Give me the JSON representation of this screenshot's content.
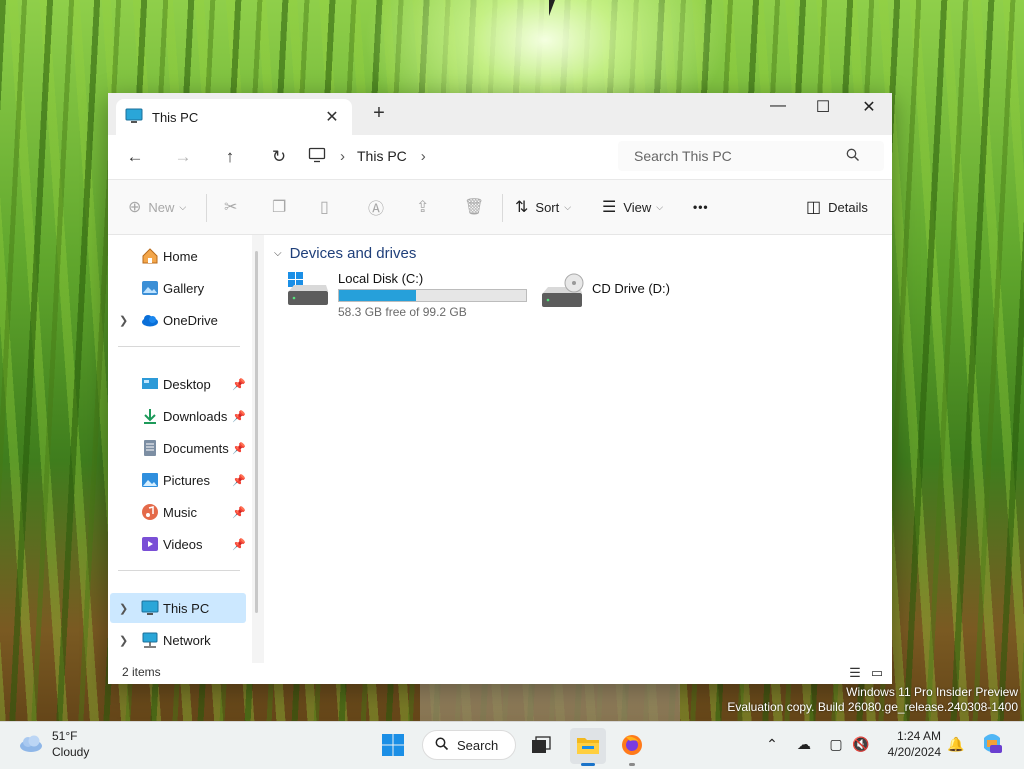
{
  "window": {
    "tab_title": "This PC",
    "tab_close": "✕",
    "new_tab": "+",
    "minimize": "—",
    "maximize": "☐",
    "close": "✕"
  },
  "nav": {
    "back": "←",
    "forward": "→",
    "up": "↑",
    "refresh": "↻"
  },
  "address": {
    "crumb": "This PC",
    "sep": "›"
  },
  "search": {
    "placeholder": "Search This PC"
  },
  "commands": {
    "new": "New",
    "sort": "Sort",
    "view": "View",
    "more": "•••",
    "details": "Details"
  },
  "sidebar": {
    "home": "Home",
    "gallery": "Gallery",
    "onedrive": "OneDrive",
    "desktop": "Desktop",
    "downloads": "Downloads",
    "documents": "Documents",
    "pictures": "Pictures",
    "music": "Music",
    "videos": "Videos",
    "this_pc": "This PC",
    "network": "Network"
  },
  "content": {
    "group_title": "Devices and drives",
    "drives": [
      {
        "name": "Local Disk (C:)",
        "free_text": "58.3 GB free of 99.2 GB",
        "used_fraction": 0.41
      },
      {
        "name": "CD Drive (D:)"
      }
    ]
  },
  "status": {
    "items": "2 items"
  },
  "watermark": {
    "line1": "Windows 11 Pro Insider Preview",
    "line2": "Evaluation copy. Build 26080.ge_release.240308-1400"
  },
  "taskbar": {
    "weather_temp": "51°F",
    "weather_desc": "Cloudy",
    "search_label": "Search",
    "time": "1:24 AM",
    "date": "4/20/2024"
  },
  "colors": {
    "accent": "#0078d4",
    "selection": "#cce8ff",
    "drive_bar": "#26a0da"
  }
}
